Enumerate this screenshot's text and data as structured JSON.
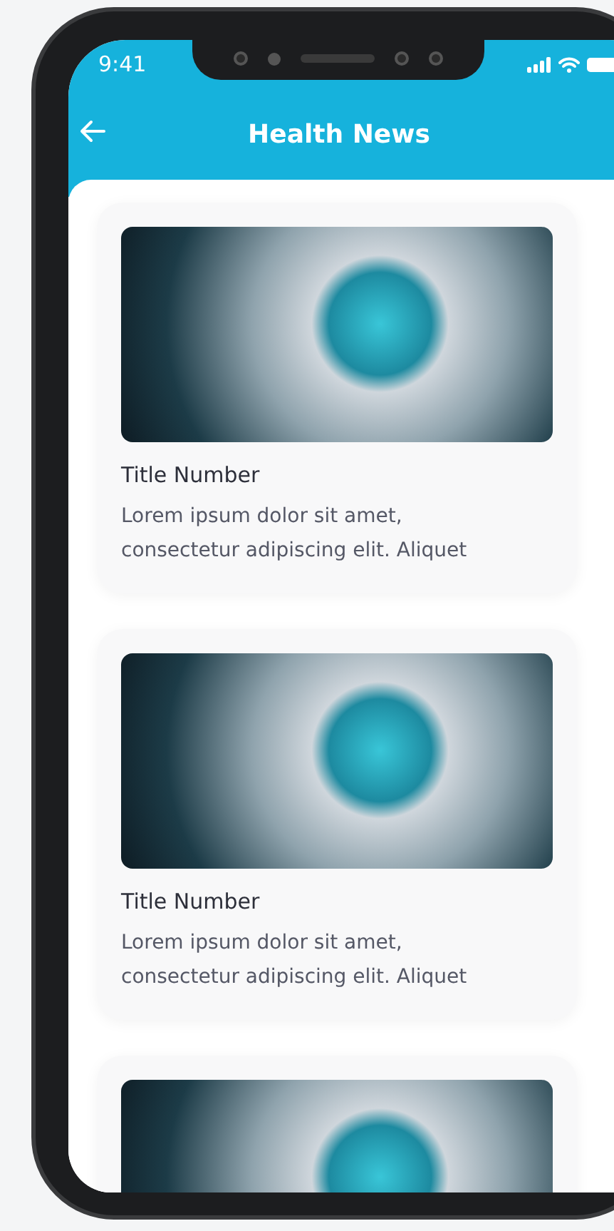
{
  "status_bar": {
    "time": "9:41"
  },
  "header": {
    "title": "Health News"
  },
  "articles": [
    {
      "title": "Title Number",
      "body": "Lorem ipsum dolor sit amet, consectetur adipiscing elit. Aliquet"
    },
    {
      "title": "Title Number",
      "body": "Lorem ipsum dolor sit amet, consectetur adipiscing elit. Aliquet"
    }
  ],
  "partial_article_visible": true
}
